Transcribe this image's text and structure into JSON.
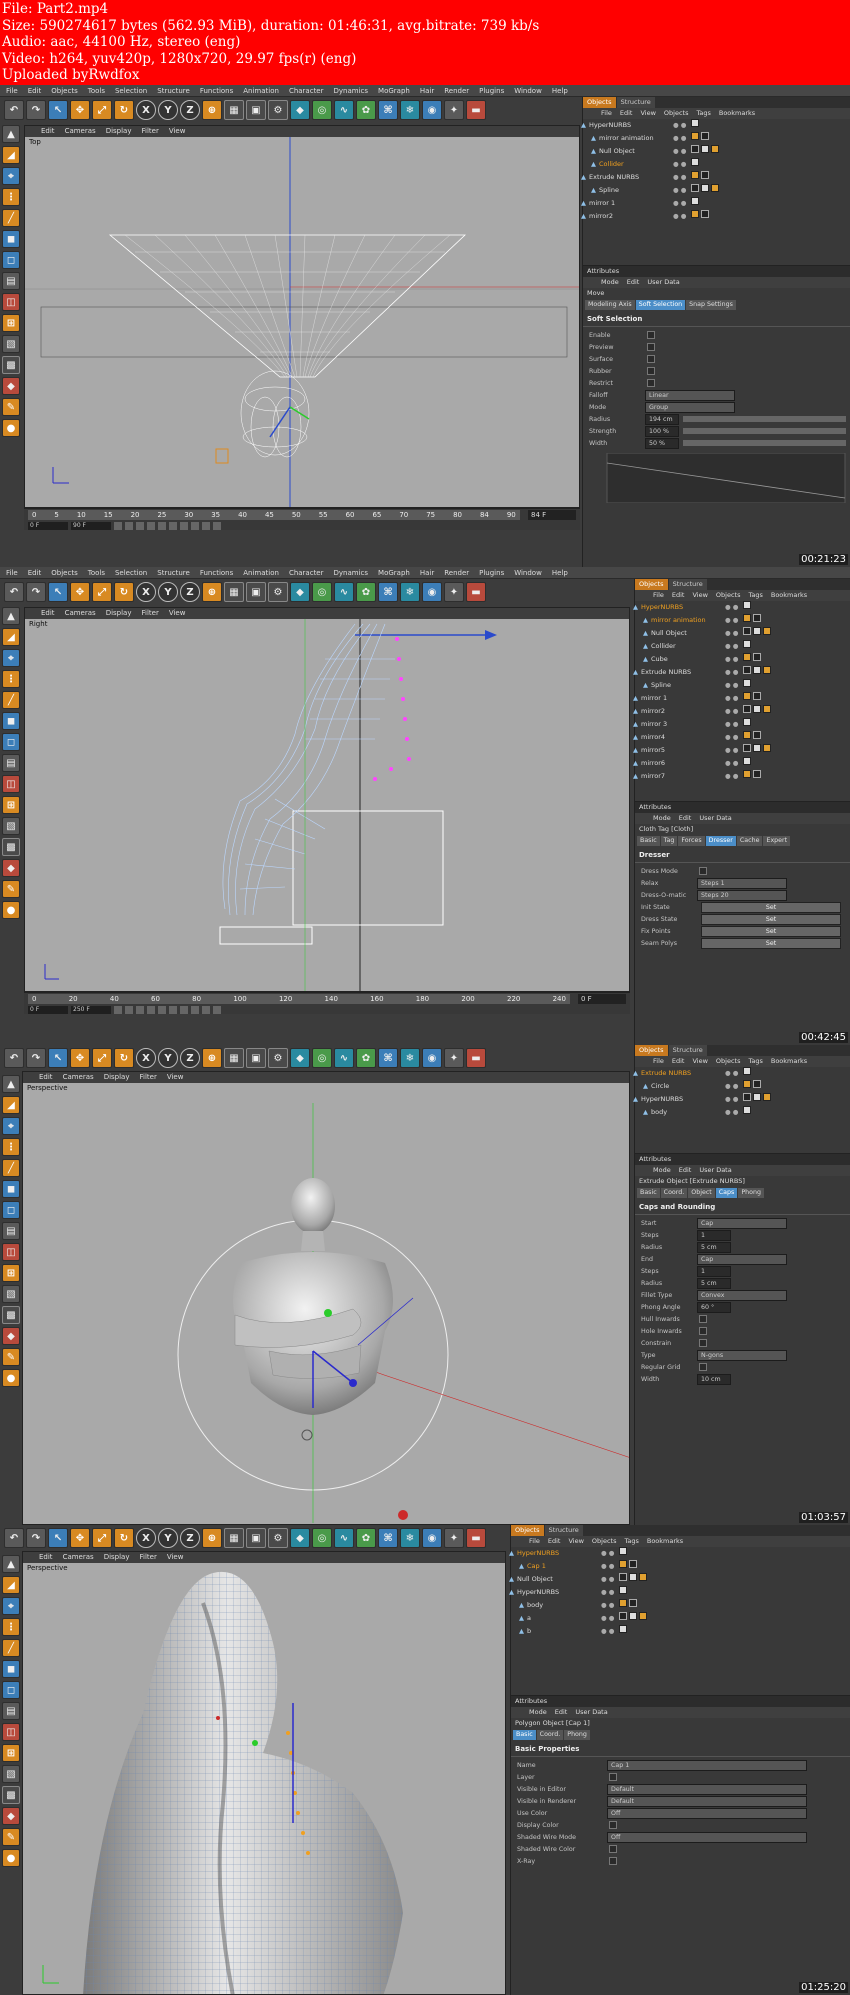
{
  "header": {
    "lines": [
      "File: Part2.mp4",
      "Size: 590274617 bytes (562.93 MiB), duration: 01:46:31, avg.bitrate: 739 kb/s",
      "Audio: aac, 44100 Hz, stereo (eng)",
      "Video: h264, yuv420p, 1280x720, 29.97 fps(r) (eng)",
      "Uploaded byRwdfox"
    ]
  },
  "menu": [
    "File",
    "Edit",
    "Objects",
    "Tools",
    "Selection",
    "Structure",
    "Functions",
    "Animation",
    "Character",
    "Dynamics",
    "MoGraph",
    "Hair",
    "Render",
    "Plugins",
    "Window",
    "Help"
  ],
  "viewport_menu": [
    "Edit",
    "Cameras",
    "Display",
    "Filter",
    "View"
  ],
  "panel_tabs": [
    "Objects",
    "Structure"
  ],
  "panel_menu": [
    "File",
    "Edit",
    "View",
    "Objects",
    "Tags",
    "Bookmarks"
  ],
  "attr_menu": [
    "Mode",
    "Edit",
    "User Data"
  ],
  "attributes_title": "Attributes",
  "frames": [
    {
      "timestamp": "00:21:23",
      "viewport_label": "Top",
      "ticks": [
        "0",
        "5",
        "10",
        "15",
        "20",
        "25",
        "30",
        "35",
        "40",
        "45",
        "50",
        "55",
        "60",
        "65",
        "70",
        "75",
        "80",
        "84",
        "90"
      ],
      "frame_field": "84 F",
      "time_fields": [
        "0 F",
        "90 F"
      ],
      "objects": [
        {
          "name": "HyperNURBS",
          "indent": 0,
          "sel": false
        },
        {
          "name": "mirror animation",
          "indent": 1,
          "sel": false
        },
        {
          "name": "Null Object",
          "indent": 1,
          "sel": false
        },
        {
          "name": "Collider",
          "indent": 1,
          "sel": true
        },
        {
          "name": "Extrude NURBS",
          "indent": 0,
          "sel": false
        },
        {
          "name": "Spline",
          "indent": 1,
          "sel": false
        },
        {
          "name": "mirror 1",
          "indent": 0,
          "sel": false
        },
        {
          "name": "mirror2",
          "indent": 0,
          "sel": false
        }
      ],
      "attr_title": "Move",
      "attr_tabs": [
        "Modeling Axis",
        "Soft Selection",
        "Snap Settings"
      ],
      "section": "Soft Selection",
      "fields": [
        {
          "label": "Enable",
          "value": ""
        },
        {
          "label": "Preview",
          "value": ""
        },
        {
          "label": "Surface",
          "value": ""
        },
        {
          "label": "Rubber",
          "value": ""
        },
        {
          "label": "Restrict",
          "value": ""
        },
        {
          "label": "Falloff",
          "value": "Linear"
        },
        {
          "label": "Mode",
          "value": "Group"
        },
        {
          "label": "Radius",
          "value": "194 cm"
        },
        {
          "label": "Strength",
          "value": "100 %"
        },
        {
          "label": "Width",
          "value": "50 %"
        }
      ]
    },
    {
      "timestamp": "00:42:45",
      "viewport_label": "Right",
      "ticks": [
        "0",
        "20",
        "40",
        "60",
        "80",
        "100",
        "120",
        "140",
        "160",
        "180",
        "200",
        "220",
        "240"
      ],
      "frame_field": "0 F",
      "time_fields": [
        "0 F",
        "250 F"
      ],
      "objects": [
        {
          "name": "HyperNURBS",
          "indent": 0,
          "sel": true
        },
        {
          "name": "mirror animation",
          "indent": 1,
          "sel": true
        },
        {
          "name": "Null Object",
          "indent": 1,
          "sel": false
        },
        {
          "name": "Collider",
          "indent": 1,
          "sel": false
        },
        {
          "name": "Cube",
          "indent": 1,
          "sel": false
        },
        {
          "name": "Extrude NURBS",
          "indent": 0,
          "sel": false
        },
        {
          "name": "Spline",
          "indent": 1,
          "sel": false
        },
        {
          "name": "mirror 1",
          "indent": 0,
          "sel": false
        },
        {
          "name": "mirror2",
          "indent": 0,
          "sel": false
        },
        {
          "name": "mirror 3",
          "indent": 0,
          "sel": false
        },
        {
          "name": "mirror4",
          "indent": 0,
          "sel": false
        },
        {
          "name": "mirror5",
          "indent": 0,
          "sel": false
        },
        {
          "name": "mirror6",
          "indent": 0,
          "sel": false
        },
        {
          "name": "mirror7",
          "indent": 0,
          "sel": false
        }
      ],
      "attr_title": "Cloth Tag [Cloth]",
      "attr_tabs": [
        "Basic",
        "Tag",
        "Forces",
        "Dresser",
        "Cache",
        "Expert"
      ],
      "section": "Dresser",
      "fields": [
        {
          "label": "Dress Mode",
          "value": ""
        },
        {
          "label": "Relax",
          "value": "Steps 1"
        },
        {
          "label": "Dress-O-matic",
          "value": "Steps 20"
        },
        {
          "label": "Init State",
          "value": "Set"
        },
        {
          "label": "Dress State",
          "value": "Set"
        },
        {
          "label": "Fix Points",
          "value": "Set"
        },
        {
          "label": "Seam Polys",
          "value": "Set"
        }
      ]
    },
    {
      "timestamp": "01:03:57",
      "viewport_label": "Perspective",
      "objects": [
        {
          "name": "Extrude NURBS",
          "indent": 0,
          "sel": true
        },
        {
          "name": "Circle",
          "indent": 1,
          "sel": false
        },
        {
          "name": "HyperNURBS",
          "indent": 0,
          "sel": false
        },
        {
          "name": "body",
          "indent": 1,
          "sel": false
        }
      ],
      "attr_title": "Extrude Object [Extrude NURBS]",
      "attr_tabs": [
        "Basic",
        "Coord.",
        "Object",
        "Caps",
        "Phong"
      ],
      "section": "Caps and Rounding",
      "fields": [
        {
          "label": "Start",
          "value": "Cap"
        },
        {
          "label": "Steps",
          "value": "1"
        },
        {
          "label": "Radius",
          "value": "5 cm"
        },
        {
          "label": "End",
          "value": "Cap"
        },
        {
          "label": "Steps",
          "value": "1"
        },
        {
          "label": "Radius",
          "value": "5 cm"
        },
        {
          "label": "Fillet Type",
          "value": "Convex"
        },
        {
          "label": "Phong Angle",
          "value": "60 °"
        },
        {
          "label": "Hull Inwards",
          "value": ""
        },
        {
          "label": "Hole Inwards",
          "value": ""
        },
        {
          "label": "Constrain",
          "value": ""
        },
        {
          "label": "Type",
          "value": "N-gons"
        },
        {
          "label": "Regular Grid",
          "value": ""
        },
        {
          "label": "Width",
          "value": "10 cm"
        }
      ]
    },
    {
      "timestamp": "01:25:20",
      "viewport_label": "Perspective",
      "objects": [
        {
          "name": "HyperNURBS",
          "indent": 0,
          "sel": true
        },
        {
          "name": "Cap 1",
          "indent": 1,
          "sel": true
        },
        {
          "name": "Null Object",
          "indent": 0,
          "sel": false
        },
        {
          "name": "HyperNURBS",
          "indent": 0,
          "sel": false
        },
        {
          "name": "body",
          "indent": 1,
          "sel": false
        },
        {
          "name": "a",
          "indent": 1,
          "sel": false
        },
        {
          "name": "b",
          "indent": 1,
          "sel": false
        }
      ],
      "attr_title": "Polygon Object [Cap 1]",
      "attr_tabs": [
        "Basic",
        "Coord.",
        "Phong"
      ],
      "section": "Basic Properties",
      "fields": [
        {
          "label": "Name",
          "value": "Cap 1"
        },
        {
          "label": "Layer",
          "value": ""
        },
        {
          "label": "Visible in Editor",
          "value": "Default"
        },
        {
          "label": "Visible in Renderer",
          "value": "Default"
        },
        {
          "label": "Use Color",
          "value": "Off"
        },
        {
          "label": "Display Color",
          "value": ""
        },
        {
          "label": "Shaded Wire Mode",
          "value": "Off"
        },
        {
          "label": "Shaded Wire Color",
          "value": ""
        },
        {
          "label": "X-Ray",
          "value": ""
        }
      ]
    }
  ],
  "colors": {
    "accent": "#c8791f",
    "header": "#ff0000",
    "selected": "#f0a020",
    "viewport": "#a9a9a9"
  }
}
